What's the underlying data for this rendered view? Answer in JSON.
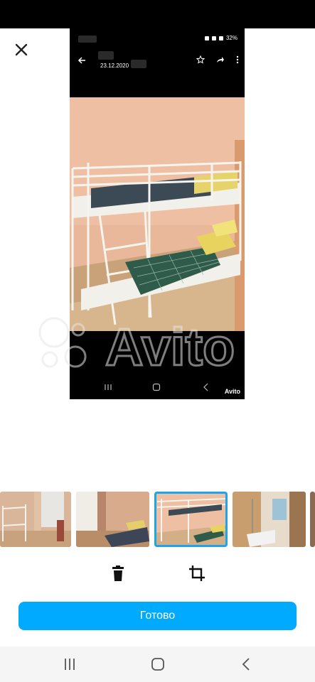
{
  "viewer": {
    "close_icon": "close-icon",
    "preview": {
      "status_battery": "32%",
      "date": "23.12.2020",
      "watermark_text": "Avito",
      "small_logo_text": "Avito"
    }
  },
  "thumbnails": [
    {
      "name": "thumb-room-bunkbed-window",
      "selected": false
    },
    {
      "name": "thumb-room-beds",
      "selected": false
    },
    {
      "name": "thumb-bunkbed-closeup",
      "selected": true
    },
    {
      "name": "thumb-bathroom",
      "selected": false
    },
    {
      "name": "thumb-partial",
      "selected": false
    }
  ],
  "actions": {
    "delete_icon": "trash-icon",
    "crop_icon": "crop-icon"
  },
  "primary": {
    "done_label": "Готово"
  },
  "system_nav": {
    "recents_icon": "recents-icon",
    "home_icon": "home-icon",
    "back_icon": "back-icon"
  },
  "colors": {
    "accent": "#00aaff",
    "selected_outline": "#1aa5ec"
  }
}
